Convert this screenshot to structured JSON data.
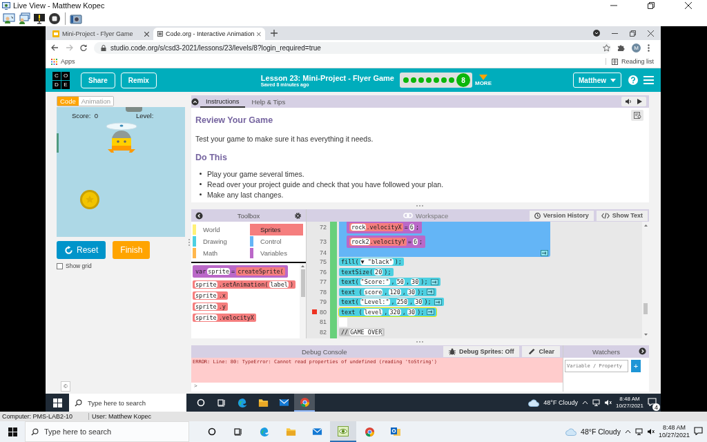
{
  "live_view": {
    "title": "Live View - Matthew Kopec"
  },
  "browser": {
    "tabs": [
      {
        "title": "Mini-Project - Flyer Game",
        "selected": false,
        "kind": "slides"
      },
      {
        "title": "Code.org - Interactive Animation",
        "selected": true,
        "kind": "code"
      }
    ],
    "url": "studio.code.org/s/csd3-2021/lessons/23/levels/8?login_required=true",
    "profile_initial": "M",
    "bookmarks": [
      "Apps"
    ],
    "reading_list": "Reading list"
  },
  "header": {
    "logo": [
      "C",
      "O",
      "D",
      "E"
    ],
    "buttons": [
      "Share",
      "Remix"
    ],
    "lesson_title": "Lesson 23: Mini-Project - Flyer Game",
    "saved": "Saved 8 minutes ago",
    "levels": [
      {
        "kind": "dot"
      },
      {
        "kind": "dot"
      },
      {
        "kind": "dot"
      },
      {
        "kind": "dot"
      },
      {
        "kind": "dot"
      },
      {
        "kind": "dot"
      },
      {
        "kind": "dot"
      },
      {
        "kind": "current",
        "label": "8"
      }
    ],
    "more": "MORE",
    "user_menu": "Matthew"
  },
  "left": {
    "mode_toggle": [
      {
        "label": "Code",
        "selected": true
      },
      {
        "label": "Animation",
        "selected": false
      }
    ],
    "canvas": {
      "score": "Score:  0",
      "level": "Level:"
    },
    "buttons": [
      {
        "label": "Reset",
        "kind": "reset"
      },
      {
        "label": "Finish",
        "kind": "finish"
      }
    ],
    "show_grid": {
      "label": "Show grid",
      "checked": false
    },
    "footer": "©"
  },
  "instructions": {
    "tabs": [
      {
        "label": "Instructions",
        "selected": true
      },
      {
        "label": "Help & Tips",
        "selected": false
      }
    ],
    "heading": "Review Your Game",
    "text": "Test your game to make sure it has everything it needs.",
    "subheading": "Do This",
    "bullets": [
      "Play your game several times.",
      "Read over your project guide and check that you have followed your plan.",
      "Make any last changes."
    ]
  },
  "toolbox": {
    "title": "Toolbox",
    "categories": [
      {
        "label": "World",
        "color": "#fff176",
        "selected": false
      },
      {
        "label": "Sprites",
        "color": "#f57e7e",
        "selected": true
      },
      {
        "label": "Drawing",
        "color": "#4dd0e1",
        "selected": false
      },
      {
        "label": "Control",
        "color": "#64b5f6",
        "selected": false
      },
      {
        "label": "Math",
        "color": "#ffb74d",
        "selected": false
      },
      {
        "label": "Variables",
        "color": "#ba68c8",
        "selected": false
      }
    ],
    "blocks": [
      {
        "kind": "variables",
        "parts": [
          {
            "kind": "text",
            "text": "var"
          },
          {
            "kind": "slot",
            "text": "sprite"
          },
          {
            "kind": "text",
            "text": "="
          },
          {
            "kind": "inner",
            "parts": [
              {
                "kind": "text",
                "text": "createSprite("
              }
            ]
          }
        ]
      },
      {
        "kind": "sprites",
        "parts": [
          {
            "kind": "slot",
            "text": "sprite"
          },
          {
            "kind": "text",
            "text": ".setAnimation("
          },
          {
            "kind": "slot",
            "text": "label"
          },
          {
            "kind": "text",
            "text": ")"
          }
        ]
      },
      {
        "kind": "sprites",
        "parts": [
          {
            "kind": "slot",
            "text": "sprite"
          },
          {
            "kind": "text",
            "text": ".x"
          }
        ]
      },
      {
        "kind": "sprites",
        "parts": [
          {
            "kind": "slot",
            "text": "sprite"
          },
          {
            "kind": "text",
            "text": ".y"
          }
        ]
      },
      {
        "kind": "sprites",
        "parts": [
          {
            "kind": "slot",
            "text": "sprite"
          },
          {
            "kind": "text",
            "text": ".velocityX"
          }
        ]
      }
    ]
  },
  "workspace": {
    "title": "Workspace",
    "buttons": [
      {
        "label": "Version History",
        "kind": "history"
      },
      {
        "label": "Show Text",
        "kind": "code"
      }
    ],
    "lines": [
      {
        "kind": "control",
        "end_number": "74",
        "children": [
          {
            "number": "72",
            "kind": "variables",
            "parts": [
              {
                "kind": "inner",
                "parts": [
                  {
                    "kind": "slot",
                    "text": "rock"
                  },
                  {
                    "kind": "text",
                    "text": ".velocityX"
                  }
                ]
              },
              {
                "kind": "text",
                "text": "="
              },
              {
                "kind": "slot",
                "text": "6"
              },
              {
                "kind": "text",
                "text": ";"
              }
            ]
          },
          {
            "number": "73",
            "kind": "variables",
            "parts": [
              {
                "kind": "inner",
                "parts": [
                  {
                    "kind": "slot",
                    "text": "rock2"
                  },
                  {
                    "kind": "text",
                    "text": ".velocityY"
                  }
                ]
              },
              {
                "kind": "text",
                "text": "="
              },
              {
                "kind": "slot",
                "text": "6"
              },
              {
                "kind": "text",
                "text": ";"
              }
            ]
          }
        ]
      },
      {
        "number": "75",
        "kind": "drawing",
        "parts": [
          {
            "kind": "text",
            "text": "fill("
          },
          {
            "kind": "slot",
            "text": "▼ \"black\""
          },
          {
            "kind": "text",
            "text": ");"
          }
        ]
      },
      {
        "number": "76",
        "kind": "drawing",
        "parts": [
          {
            "kind": "text",
            "text": "textSize("
          },
          {
            "kind": "slot",
            "text": "20"
          },
          {
            "kind": "text",
            "text": ");"
          }
        ]
      },
      {
        "number": "77",
        "kind": "drawing",
        "end_cap": true,
        "parts": [
          {
            "kind": "text",
            "text": "text("
          },
          {
            "kind": "slot",
            "text": "\"Score:\""
          },
          {
            "kind": "text",
            "text": ","
          },
          {
            "kind": "slot",
            "text": "50"
          },
          {
            "kind": "text",
            "text": ","
          },
          {
            "kind": "slot",
            "text": "30"
          },
          {
            "kind": "text",
            "text": ");"
          }
        ]
      },
      {
        "number": "78",
        "kind": "drawing",
        "end_cap": true,
        "parts": [
          {
            "kind": "text",
            "text": "text ("
          },
          {
            "kind": "slot",
            "text": "score"
          },
          {
            "kind": "text",
            "text": ","
          },
          {
            "kind": "slot",
            "text": "120"
          },
          {
            "kind": "text",
            "text": ","
          },
          {
            "kind": "slot",
            "text": "30"
          },
          {
            "kind": "text",
            "text": ");"
          }
        ]
      },
      {
        "number": "79",
        "kind": "drawing",
        "end_cap": true,
        "parts": [
          {
            "kind": "text",
            "text": "text("
          },
          {
            "kind": "slot",
            "text": "\"Level:\""
          },
          {
            "kind": "text",
            "text": ","
          },
          {
            "kind": "slot",
            "text": "250"
          },
          {
            "kind": "text",
            "text": ","
          },
          {
            "kind": "slot",
            "text": "30"
          },
          {
            "kind": "text",
            "text": ");"
          }
        ]
      },
      {
        "number": "80",
        "kind": "drawing",
        "end_cap": true,
        "error": true,
        "parts": [
          {
            "kind": "text",
            "text": "text ("
          },
          {
            "kind": "slot",
            "text": "level"
          },
          {
            "kind": "text",
            "text": ","
          },
          {
            "kind": "slot",
            "text": "320"
          },
          {
            "kind": "text",
            "text": ","
          },
          {
            "kind": "slot",
            "text": "30"
          },
          {
            "kind": "text",
            "text": ");"
          }
        ]
      },
      {
        "number": "81",
        "kind": "empty"
      },
      {
        "number": "82",
        "kind": "comment",
        "parts": [
          {
            "kind": "text",
            "text": "//"
          },
          {
            "kind": "slot",
            "text": "GAME OVER"
          }
        ]
      }
    ]
  },
  "debug": {
    "title": "Debug Console",
    "buttons": [
      {
        "label": "Debug Sprites: Off",
        "kind": "bug"
      },
      {
        "label": "Clear",
        "kind": "eraser"
      }
    ],
    "error": "ERROR: Line: 80: TypeError: Cannot read properties of undefined (reading 'toString')",
    "prompt": ">"
  },
  "watchers": {
    "title": "Watchers",
    "placeholder": "Variable / Property",
    "add": "+"
  },
  "remote_taskbar": {
    "search": "Type here to search",
    "apps": [
      {
        "kind": "cortana",
        "selected": false
      },
      {
        "kind": "taskview",
        "selected": false
      },
      {
        "kind": "edge",
        "selected": false
      },
      {
        "kind": "explorer",
        "selected": false
      },
      {
        "kind": "mail",
        "selected": false
      },
      {
        "kind": "chrome",
        "selected": true
      }
    ],
    "weather": "48°F  Cloudy",
    "time": "8:48 AM",
    "date": "10/27/2021",
    "notifications": "4"
  },
  "status_bar": {
    "computer": "Computer: PMS-LAB2-10",
    "user": "User: Matthew Kopec"
  },
  "local_taskbar": {
    "search": "Type here to search",
    "apps": [
      {
        "kind": "cortana",
        "selected": false
      },
      {
        "kind": "taskview",
        "selected": false
      },
      {
        "kind": "edge",
        "selected": false
      },
      {
        "kind": "explorer",
        "selected": false
      },
      {
        "kind": "mail",
        "selected": false
      },
      {
        "kind": "eye",
        "selected": true
      },
      {
        "kind": "chrome",
        "selected": false
      },
      {
        "kind": "outlook",
        "selected": false
      }
    ],
    "weather": "48°F  Cloudy",
    "time": "8:48 AM",
    "date": "10/27/2021"
  }
}
